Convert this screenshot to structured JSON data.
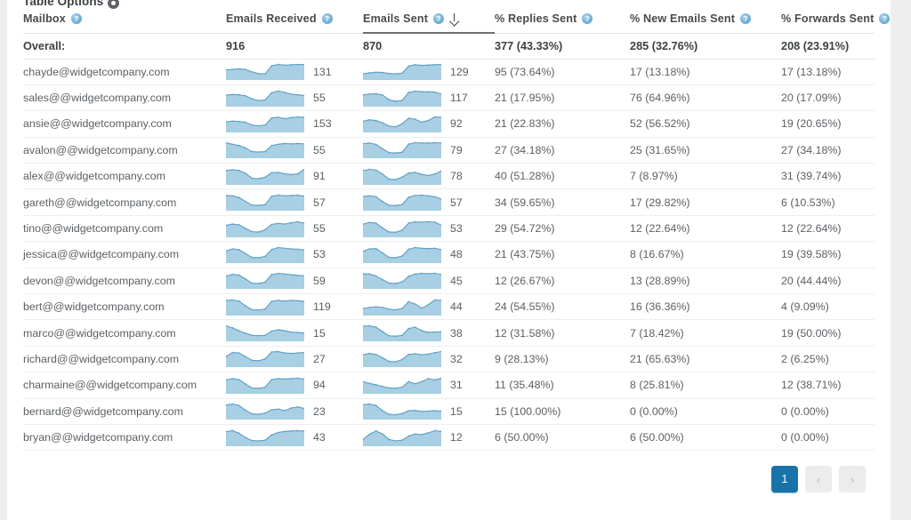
{
  "panel": {
    "table_options_label": "Table Options",
    "gear_icon": "gear-icon"
  },
  "table": {
    "columns": [
      {
        "key": "mailbox",
        "label": "Mailbox",
        "help": "?",
        "sorted": false
      },
      {
        "key": "received",
        "label": "Emails Received",
        "help": "?",
        "sorted": false
      },
      {
        "key": "sent",
        "label": "Emails Sent",
        "help": "?",
        "sorted": true,
        "sort_dir": "desc",
        "sort_icon": "arrow-down-icon"
      },
      {
        "key": "replies",
        "label": "% Replies Sent",
        "help": "?",
        "sorted": false
      },
      {
        "key": "new",
        "label": "% New Emails Sent",
        "help": "?",
        "sorted": false
      },
      {
        "key": "forwards",
        "label": "% Forwards Sent",
        "help": "?",
        "sorted": false
      }
    ],
    "overall": {
      "label": "Overall:",
      "received": "916",
      "sent": "870",
      "replies": "377 (43.33%)",
      "new": "285 (32.76%)",
      "forwards": "208 (23.91%)"
    },
    "rows": [
      {
        "mailbox": "chayde@widgetcompany.com",
        "received": "131",
        "sent": "129",
        "replies": "95 (73.64%)",
        "new": "17 (13.18%)",
        "forwards": "17 (13.18%)",
        "spark_received": [
          52,
          55,
          58,
          54,
          40,
          30,
          28,
          76,
          84,
          80,
          82,
          84,
          83
        ],
        "spark_sent": [
          30,
          36,
          40,
          38,
          32,
          30,
          34,
          78,
          86,
          82,
          84,
          86,
          88
        ]
      },
      {
        "mailbox": "sales@@widgetcompany.com",
        "received": "55",
        "sent": "117",
        "replies": "21 (17.95%)",
        "new": "76 (64.96%)",
        "forwards": "20 (17.09%)",
        "spark_received": [
          60,
          64,
          62,
          56,
          38,
          28,
          32,
          74,
          84,
          76,
          66,
          62,
          58
        ],
        "spark_sent": [
          64,
          70,
          72,
          64,
          34,
          26,
          30,
          80,
          88,
          84,
          84,
          82,
          70
        ]
      },
      {
        "mailbox": "ansie@@widgetcompany.com",
        "received": "153",
        "sent": "92",
        "replies": "21 (22.83%)",
        "new": "52 (56.52%)",
        "forwards": "19 (20.65%)",
        "spark_received": [
          52,
          56,
          54,
          50,
          34,
          30,
          34,
          74,
          78,
          70,
          76,
          80,
          78
        ],
        "spark_sent": [
          60,
          68,
          64,
          50,
          30,
          26,
          44,
          78,
          72,
          54,
          64,
          86,
          84
        ]
      },
      {
        "mailbox": "avalon@@widgetcompany.com",
        "received": "55",
        "sent": "79",
        "replies": "27 (34.18%)",
        "new": "25 (31.65%)",
        "forwards": "27 (34.18%)",
        "spark_received": [
          70,
          62,
          56,
          44,
          26,
          24,
          26,
          56,
          62,
          66,
          64,
          66,
          64
        ],
        "spark_sent": [
          74,
          78,
          70,
          46,
          24,
          22,
          26,
          72,
          80,
          78,
          78,
          80,
          78
        ]
      },
      {
        "mailbox": "alex@@widgetcompany.com",
        "received": "91",
        "sent": "78",
        "replies": "40 (51.28%)",
        "new": "7 (8.97%)",
        "forwards": "31 (39.74%)",
        "spark_received": [
          70,
          74,
          70,
          54,
          28,
          26,
          34,
          58,
          60,
          52,
          48,
          52,
          76
        ],
        "spark_sent": [
          76,
          84,
          80,
          56,
          26,
          24,
          38,
          62,
          66,
          54,
          48,
          56,
          74
        ]
      },
      {
        "mailbox": "gareth@@widgetcompany.com",
        "received": "57",
        "sent": "57",
        "replies": "34 (59.65%)",
        "new": "17 (29.82%)",
        "forwards": "6 (10.53%)",
        "spark_received": [
          78,
          76,
          66,
          44,
          24,
          22,
          26,
          74,
          80,
          76,
          78,
          80,
          74
        ],
        "spark_sent": [
          76,
          80,
          74,
          46,
          24,
          22,
          28,
          72,
          82,
          84,
          80,
          74,
          62
        ]
      },
      {
        "mailbox": "tino@@widgetcompany.com",
        "received": "55",
        "sent": "53",
        "replies": "29 (54.72%)",
        "new": "12 (22.64%)",
        "forwards": "12 (22.64%)",
        "spark_received": [
          64,
          72,
          68,
          46,
          26,
          24,
          38,
          70,
          76,
          72,
          80,
          86,
          78
        ],
        "spark_sent": [
          70,
          80,
          76,
          48,
          24,
          22,
          34,
          76,
          84,
          82,
          84,
          82,
          64
        ]
      },
      {
        "mailbox": "jessica@@widgetcompany.com",
        "received": "53",
        "sent": "48",
        "replies": "21 (43.75%)",
        "new": "8 (16.67%)",
        "forwards": "19 (39.58%)",
        "spark_received": [
          64,
          76,
          72,
          48,
          26,
          24,
          32,
          72,
          84,
          80,
          76,
          74,
          70
        ],
        "spark_sent": [
          62,
          76,
          78,
          52,
          26,
          24,
          34,
          74,
          84,
          80,
          78,
          80,
          72
        ]
      },
      {
        "mailbox": "devon@@widgetcompany.com",
        "received": "59",
        "sent": "45",
        "replies": "12 (26.67%)",
        "new": "13 (28.89%)",
        "forwards": "20 (44.44%)",
        "spark_received": [
          68,
          78,
          74,
          50,
          26,
          24,
          32,
          76,
          84,
          80,
          76,
          72,
          70
        ],
        "spark_sent": [
          74,
          72,
          62,
          42,
          24,
          22,
          30,
          60,
          72,
          76,
          74,
          76,
          70
        ]
      },
      {
        "mailbox": "bert@@widgetcompany.com",
        "received": "119",
        "sent": "44",
        "replies": "24 (54.55%)",
        "new": "16 (36.36%)",
        "forwards": "4 (9.09%)",
        "spark_received": [
          80,
          82,
          76,
          48,
          26,
          24,
          30,
          74,
          80,
          76,
          80,
          78,
          74
        ],
        "spark_sent": [
          34,
          40,
          44,
          40,
          30,
          26,
          34,
          74,
          60,
          36,
          56,
          84,
          82
        ]
      },
      {
        "mailbox": "marco@@widgetcompany.com",
        "received": "15",
        "sent": "38",
        "replies": "12 (31.58%)",
        "new": "7 (18.42%)",
        "forwards": "19 (50.00%)",
        "spark_received": [
          80,
          68,
          52,
          38,
          26,
          24,
          26,
          50,
          58,
          52,
          44,
          42,
          40
        ],
        "spark_sent": [
          80,
          82,
          74,
          48,
          24,
          22,
          26,
          66,
          74,
          54,
          44,
          46,
          48
        ]
      },
      {
        "mailbox": "richard@@widgetcompany.com",
        "received": "27",
        "sent": "32",
        "replies": "9 (28.13%)",
        "new": "21 (65.63%)",
        "forwards": "2 (6.25%)",
        "spark_received": [
          40,
          58,
          56,
          40,
          24,
          22,
          30,
          60,
          62,
          56,
          54,
          56,
          58
        ],
        "spark_sent": [
          60,
          68,
          62,
          44,
          24,
          22,
          34,
          62,
          66,
          60,
          64,
          72,
          78
        ]
      },
      {
        "mailbox": "charmaine@@widgetcompany.com",
        "received": "94",
        "sent": "31",
        "replies": "11 (35.48%)",
        "new": "8 (25.81%)",
        "forwards": "12 (38.71%)",
        "spark_received": [
          72,
          80,
          74,
          48,
          26,
          24,
          30,
          74,
          80,
          78,
          80,
          82,
          78
        ],
        "spark_sent": [
          62,
          52,
          44,
          34,
          26,
          24,
          30,
          62,
          50,
          62,
          80,
          72,
          82
        ]
      },
      {
        "mailbox": "bernard@@widgetcompany.com",
        "received": "23",
        "sent": "15",
        "replies": "15 (100.00%)",
        "new": "0 (0.00%)",
        "forwards": "0 (0.00%)",
        "spark_received": [
          72,
          78,
          70,
          44,
          24,
          22,
          28,
          46,
          50,
          42,
          56,
          62,
          54
        ],
        "spark_sent": [
          76,
          80,
          72,
          42,
          22,
          20,
          26,
          42,
          44,
          38,
          40,
          42,
          40
        ]
      },
      {
        "mailbox": "bryan@@widgetcompany.com",
        "received": "43",
        "sent": "12",
        "replies": "6 (50.00%)",
        "new": "6 (50.00%)",
        "forwards": "0 (0.00%)",
        "spark_received": [
          72,
          78,
          64,
          40,
          24,
          22,
          26,
          54,
          68,
          74,
          76,
          78,
          76
        ],
        "spark_sent": [
          30,
          58,
          76,
          60,
          30,
          22,
          26,
          48,
          60,
          56,
          66,
          78,
          74
        ]
      }
    ]
  },
  "pagination": {
    "current_page": "1",
    "prev_label": "‹",
    "next_label": "›",
    "prev_icon": "chevron-left-icon",
    "next_icon": "chevron-right-icon"
  },
  "colors": {
    "accent": "#1a73a8",
    "spark_fill": "#a8cfe4",
    "spark_line": "#5d9ec4",
    "help_icon": "#6fb0d6",
    "row_border": "#eceef0"
  }
}
